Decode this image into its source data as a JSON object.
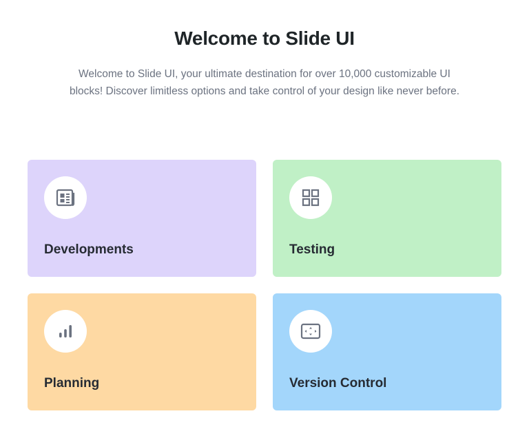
{
  "header": {
    "title": "Welcome to Slide UI",
    "description": "Welcome to Slide UI, your ultimate destination for over 10,000 customizable UI blocks! Discover limitless options and take control of your design like never before."
  },
  "cards": [
    {
      "label": "Developments",
      "icon": "newspaper-icon",
      "color": "#ddd4fb"
    },
    {
      "label": "Testing",
      "icon": "grid-icon",
      "color": "#c0f0c6"
    },
    {
      "label": "Planning",
      "icon": "bar-chart-icon",
      "color": "#fed9a3"
    },
    {
      "label": "Version Control",
      "icon": "screen-frame-icon",
      "color": "#a3d6fb"
    }
  ],
  "colors": {
    "icon": "#6b7280",
    "title": "#1f2528",
    "text": "#6b7280"
  }
}
